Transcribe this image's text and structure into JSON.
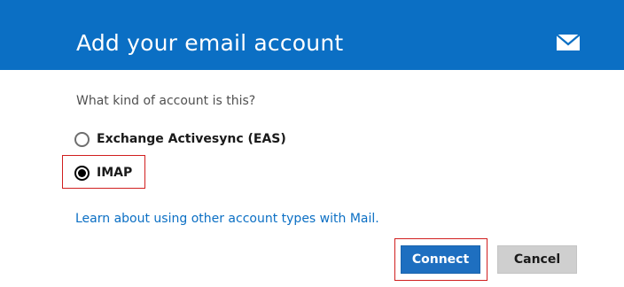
{
  "dialog": {
    "title": "Add your email account",
    "header_color": "#0b6fc4",
    "header_icon": "mail-icon"
  },
  "form": {
    "question": "What kind of account is this?",
    "options": [
      {
        "label": "Exchange Activesync (EAS)",
        "selected": false
      },
      {
        "label": "IMAP",
        "selected": true
      }
    ],
    "learn_link": "Learn about using other account types with Mail."
  },
  "buttons": {
    "connect_label": "Connect",
    "cancel_label": "Cancel"
  },
  "colors": {
    "accent": "#0b6fc4",
    "connect_bg": "#1e6fc0",
    "cancel_bg": "#cfcfcf",
    "highlight": "#d11f1f"
  }
}
